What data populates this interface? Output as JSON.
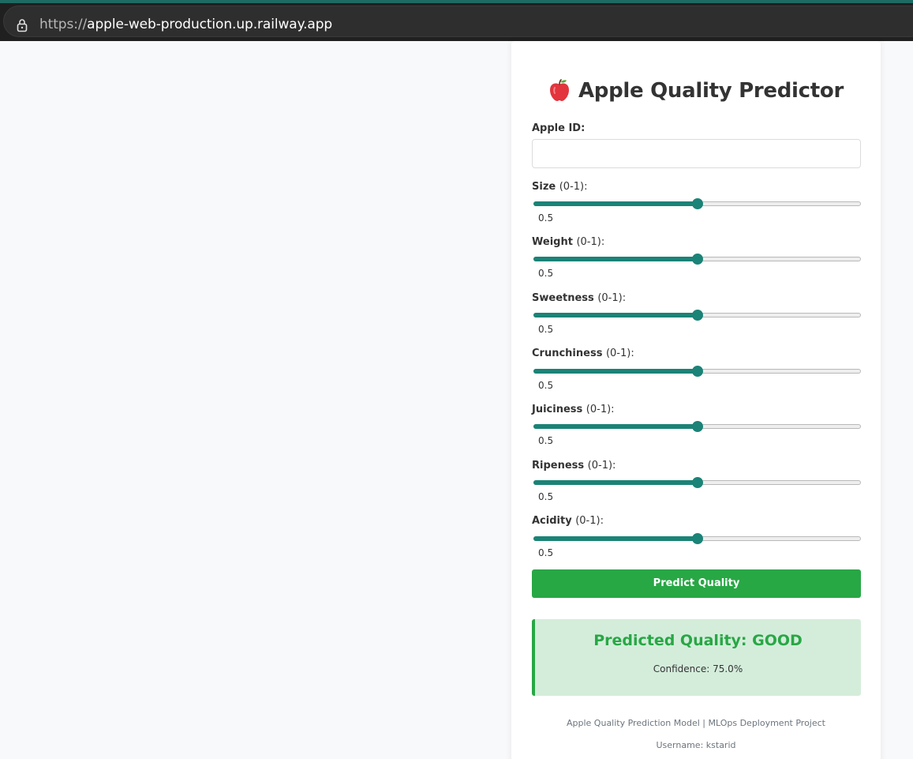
{
  "browser": {
    "url_scheme": "https://",
    "url_host": "apple-web-production.up.railway.app",
    "lock_icon": "lock-icon"
  },
  "app": {
    "title": "Apple Quality Predictor",
    "title_icon": "apple-icon",
    "apple_id_label": "Apple ID:",
    "apple_id_value": "",
    "predict_button": "Predict Quality"
  },
  "sliders": [
    {
      "name": "Size",
      "range": "(0-1):",
      "value": 0.5,
      "display": "0.5"
    },
    {
      "name": "Weight",
      "range": "(0-1):",
      "value": 0.5,
      "display": "0.5"
    },
    {
      "name": "Sweetness",
      "range": "(0-1):",
      "value": 0.5,
      "display": "0.5"
    },
    {
      "name": "Crunchiness",
      "range": "(0-1):",
      "value": 0.5,
      "display": "0.5"
    },
    {
      "name": "Juiciness",
      "range": "(0-1):",
      "value": 0.5,
      "display": "0.5"
    },
    {
      "name": "Ripeness",
      "range": "(0-1):",
      "value": 0.5,
      "display": "0.5"
    },
    {
      "name": "Acidity",
      "range": "(0-1):",
      "value": 0.5,
      "display": "0.5"
    }
  ],
  "result": {
    "title": "Predicted Quality: GOOD",
    "confidence": "Confidence: 75.0%",
    "color": "#28a745",
    "background": "#d4eddb"
  },
  "footer": {
    "line1": "Apple Quality Prediction Model | MLOps Deployment Project",
    "line2": "Username: kstarid"
  },
  "colors": {
    "accent": "#1b8377",
    "button": "#28a745"
  }
}
